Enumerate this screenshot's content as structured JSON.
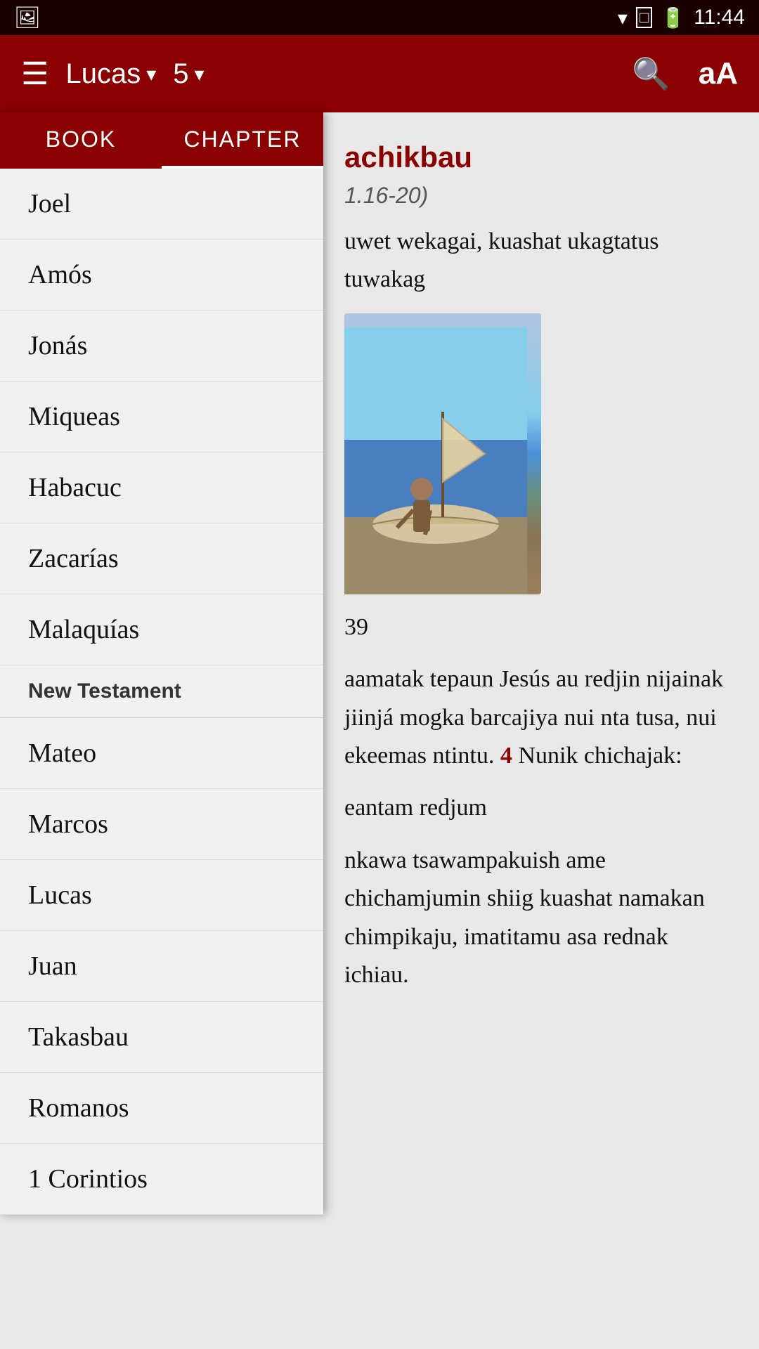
{
  "statusBar": {
    "time": "11:44",
    "icons": [
      "wifi",
      "sim",
      "battery"
    ]
  },
  "toolbar": {
    "menuIcon": "☰",
    "bookName": "Lucas",
    "chapterNumber": "5",
    "searchLabel": "search",
    "fontLabel": "font"
  },
  "tabs": {
    "bookTab": "BOOK",
    "chapterTab": "CHAPTER",
    "activeTab": "chapter"
  },
  "bookList": [
    {
      "id": "joel",
      "name": "Joel",
      "section": "old"
    },
    {
      "id": "amos",
      "name": "Amós",
      "section": "old"
    },
    {
      "id": "jonas",
      "name": "Jonás",
      "section": "old"
    },
    {
      "id": "miqueas",
      "name": "Miqueas",
      "section": "old"
    },
    {
      "id": "habacuc",
      "name": "Habacuc",
      "section": "old"
    },
    {
      "id": "zacarias",
      "name": "Zacarías",
      "section": "old"
    },
    {
      "id": "malaquias",
      "name": "Malaquías",
      "section": "old"
    }
  ],
  "newTestamentHeader": "New Testament",
  "newTestamentBooks": [
    {
      "id": "mateo",
      "name": "Mateo"
    },
    {
      "id": "marcos",
      "name": "Marcos"
    },
    {
      "id": "lucas",
      "name": "Lucas"
    },
    {
      "id": "juan",
      "name": "Juan"
    },
    {
      "id": "takasbau",
      "name": "Takasbau"
    },
    {
      "id": "romanos",
      "name": "Romanos"
    },
    {
      "id": "1corintios",
      "name": "1 Corintios"
    }
  ],
  "mainContent": {
    "title": "achikbau",
    "subtitle": "1.16-20)",
    "verse1": "uwet wekagai, kuashat ukagtatus tuwakag",
    "imageAlt": "fishing scene",
    "verseNumber": "39",
    "verse2Text": "aamatak tepaun Jesús au redjin nijainak jiinjá mogka barcajiya nui nta tusa, nui ekeemas ntintu.",
    "verse3Number": "4",
    "verse3Text": "Nunik chichajak:",
    "verse4Text": "eantam redjum",
    "verse5Text": "nkawa tsawampakuish ame chichamjumin  shiig kuashat namakan chimpikaju, imatitamu asa rednak ichiau."
  }
}
